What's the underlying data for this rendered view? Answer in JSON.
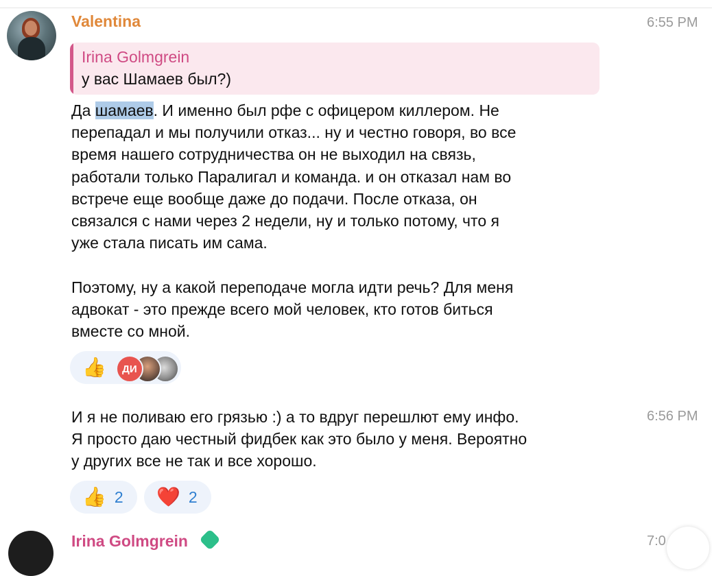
{
  "message_1": {
    "sender": "Valentina",
    "time": "6:55 PM",
    "reply": {
      "author": "Irina Golmgrein",
      "text": "у вас Шамаев был?)"
    },
    "text_before": "Да ",
    "highlighted": "шамаев",
    "text_after": ". И именно был рфе с офицером киллером. Не\nперепадал и мы получили отказ... ну и честно говоря, во все\nвремя нашего сотрудничества он не выходил на связь,\nработали только Паралигал и команда. и он отказал нам во\nвстрече еще вообще даже до подачи. После отказа, он\nсвязался с нами через 2 недели, ну и только потому, что я\nуже стала писать им сама.\n\nПоэтому, ну а какой переподаче могла идти речь? Для меня\nадвокат - это прежде всего мой человек, кто готов биться\nвместе со мной.",
    "reaction": {
      "emoji": "👍",
      "reactor_initials": "ДИ"
    }
  },
  "message_2": {
    "time": "6:56 PM",
    "text": "И я не поливаю его грязью :) а то вдруг перешлют ему инфо.\nЯ просто даю честный фидбек как это было у меня. Вероятно\nу других все не так и все хорошо.",
    "reactions": [
      {
        "emoji": "👍",
        "count": "2"
      },
      {
        "emoji": "❤️",
        "count": "2"
      }
    ]
  },
  "next_message": {
    "sender": "Irina Golmgrein",
    "time": "7:0"
  },
  "colors": {
    "valentina": "#e0883a",
    "irina": "#cf4a83",
    "reaction_bg": "#eef3fb",
    "count": "#2f7fd0",
    "highlight": "#aecbe8"
  }
}
